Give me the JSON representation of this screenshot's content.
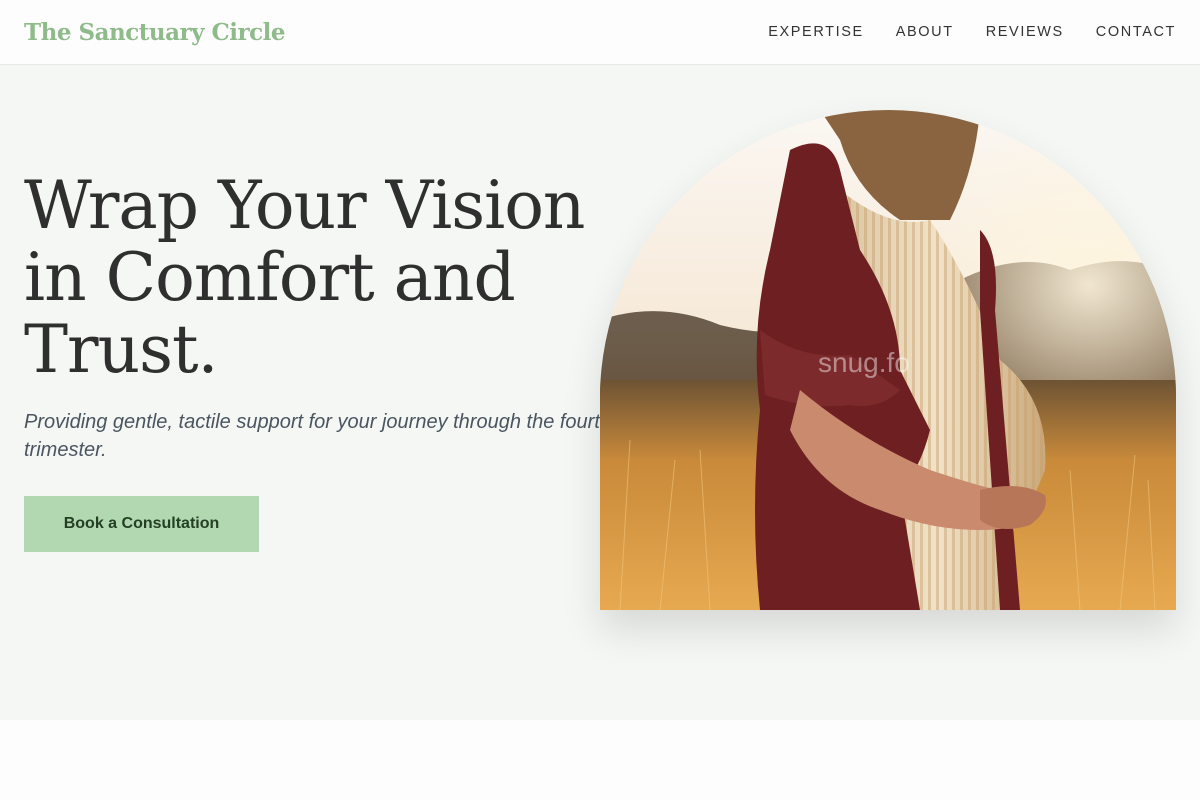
{
  "header": {
    "logo": "The Sanctuary Circle",
    "nav": [
      "EXPERTISE",
      "ABOUT",
      "REVIEWS",
      "CONTACT"
    ]
  },
  "hero": {
    "title_lines": [
      "Wrap Your Vision",
      "in Comfort and",
      "Trust."
    ],
    "subtitle": "Providing gentle, tactile support for your journey through the fourth trimester.",
    "cta_label": "Book a Consultation",
    "image_watermark": "snug.fo"
  },
  "colors": {
    "brand": "#8fba8a",
    "cta_bg": "#b1d8b0",
    "cta_text": "#244024",
    "hero_bg": "#f5f7f4"
  }
}
